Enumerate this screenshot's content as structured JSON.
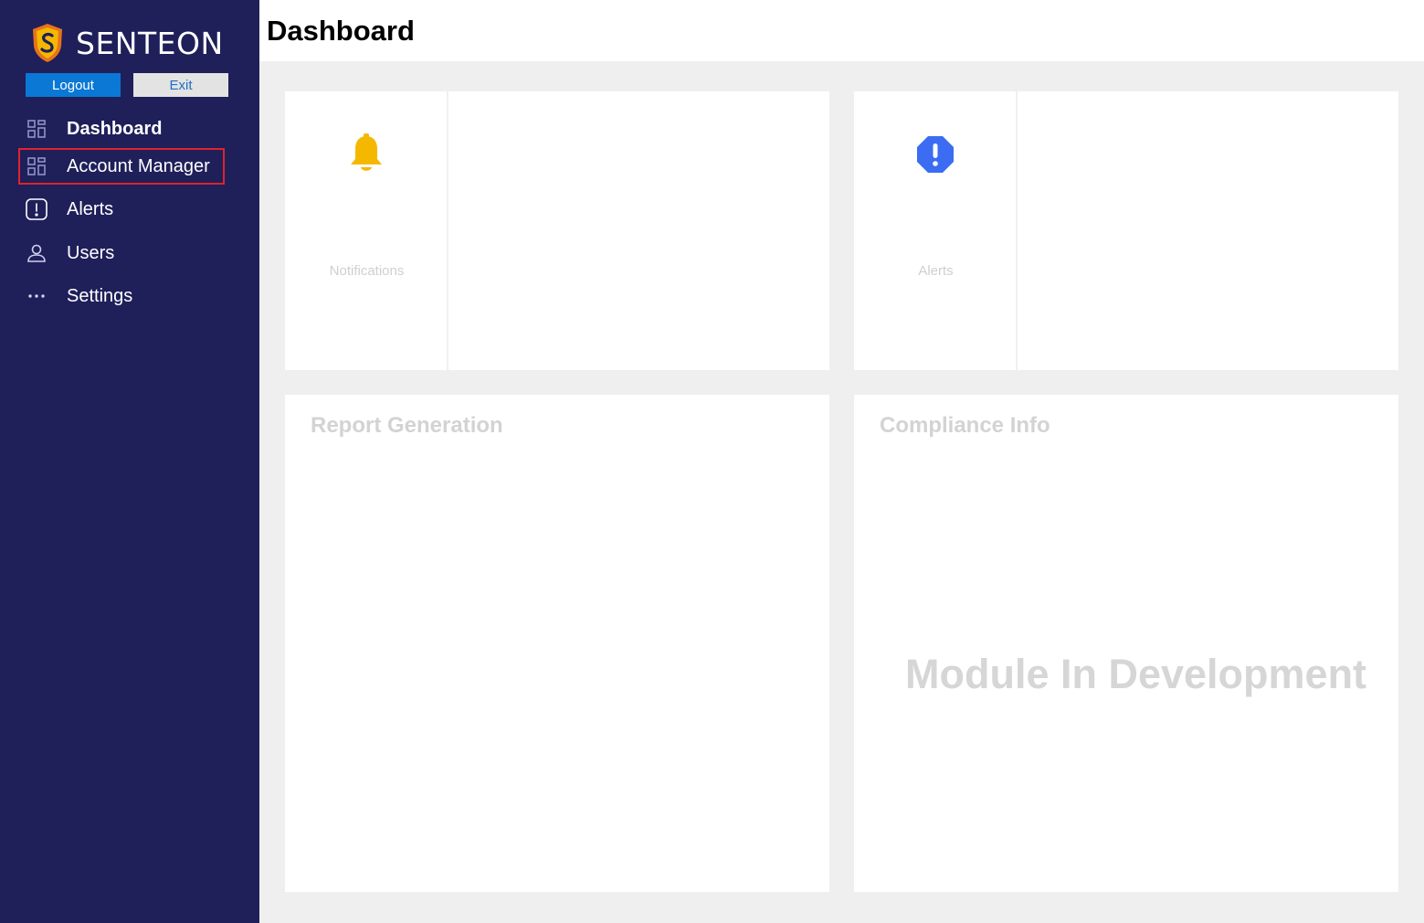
{
  "app": {
    "brand_name": "SENTEON",
    "brand_colors": {
      "shield_gold": "#f5b800",
      "shield_orange": "#e8731a",
      "sidebar_bg": "#1f1f5a"
    }
  },
  "sidebar": {
    "logout_label": "Logout",
    "exit_label": "Exit",
    "items": [
      {
        "label": "Dashboard",
        "icon": "grid-icon",
        "active": true
      },
      {
        "label": "Account Manager",
        "icon": "grid-icon",
        "highlighted": true
      },
      {
        "label": "Alerts",
        "icon": "alert-square-icon"
      },
      {
        "label": "Users",
        "icon": "user-icon"
      },
      {
        "label": "Settings",
        "icon": "ellipsis-icon"
      }
    ]
  },
  "header": {
    "title": "Dashboard"
  },
  "main": {
    "notifications_card": {
      "label": "Notifications",
      "icon": "bell-icon",
      "icon_color": "#f5b800"
    },
    "alerts_card": {
      "label": "Alerts",
      "icon": "exclamation-octagon-icon",
      "icon_color": "#3b6cf2"
    },
    "report_card": {
      "title": "Report Generation"
    },
    "compliance_card": {
      "title": "Compliance Info",
      "status_text": "Module In Development"
    }
  }
}
